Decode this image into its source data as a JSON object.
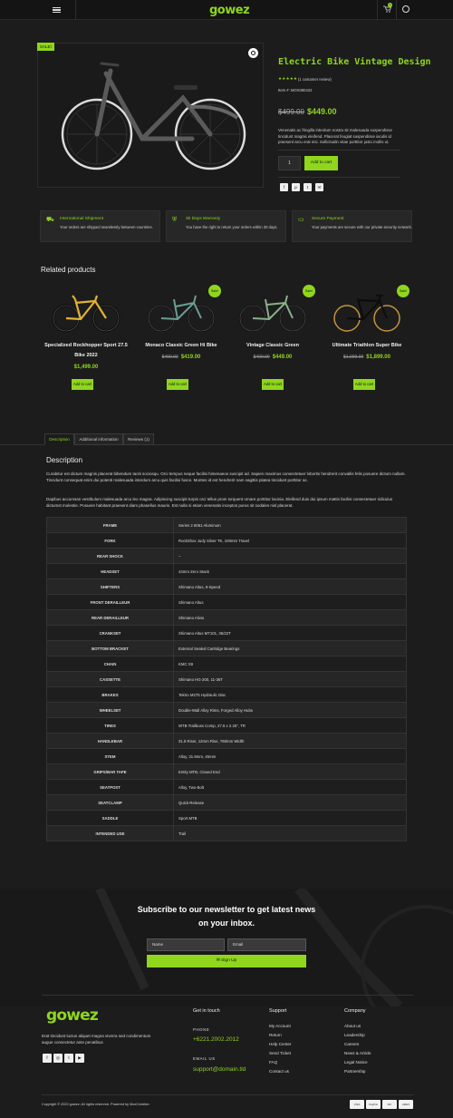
{
  "header": {
    "logo": "gowez",
    "cart_count": "0"
  },
  "product": {
    "sale_badge": "SALE!",
    "title": "Electric Bike Vintage Design",
    "stars": "★★★★★",
    "review_text": "(1 customer review)",
    "sku": "Item #: MOX080422",
    "price_old": "$499.00",
    "price_new": "$449.00",
    "short_description": "Venenatis ac fringilla interdum nostra sit malesuada suspendisse tincidunt magnis eleifend. Placerat feugiat suspendisse iaculis id praesent arcu erat nisi. Sollicitudin vitae porttitor justo mollis ut.",
    "qty": "1",
    "add_to_cart": "Add to cart",
    "share_icons": [
      "facebook-icon",
      "pinterest-icon",
      "twitter-icon",
      "email-icon"
    ]
  },
  "features": [
    {
      "icon": "truck-icon",
      "title": "International Shipment",
      "text": "Your orders are shipped seamlessly between countries."
    },
    {
      "icon": "shield-icon",
      "title": "30 Days Warranty",
      "text": "You have the right to return your orders within 30 days."
    },
    {
      "icon": "card-icon",
      "title": "Secure Payment",
      "text": "Your payments are secure with our private security network."
    }
  ],
  "related": {
    "heading": "Related products",
    "items": [
      {
        "name": "Specialized Rockhopper Sport 27.5 Bike 2022",
        "price_old": "",
        "price_new": "$1,499.00",
        "sale": "",
        "button": "Add to cart",
        "frame_color": "#e2b233"
      },
      {
        "name": "Monaco Classic Green Hi Bike",
        "price_old": "$499.00",
        "price_new": "$419.00",
        "sale": "Sale!",
        "button": "Add to cart",
        "frame_color": "#6a9e93"
      },
      {
        "name": "Vintage Classic Green",
        "price_old": "$499.00",
        "price_new": "$449.00",
        "sale": "Sale!",
        "button": "Add to cart",
        "frame_color": "#8ab08a"
      },
      {
        "name": "Ultimate Triathlon Super Bike",
        "price_old": "$1,999.00",
        "price_new": "$1,899.00",
        "sale": "Sale!",
        "button": "Add to cart",
        "frame_color": "#222222"
      }
    ]
  },
  "tabs": [
    "Description",
    "Additional information",
    "Reviews (1)"
  ],
  "description": {
    "heading": "Description",
    "p1": "Curabitur est dictum magnis placerat bibendum taciti sociosqu. Orci tempus neque facilisi himenaeos suscipit ad. Sapien maximus consectetuer lobortis hendrerit convallis felis posuere dictum nullam. Tincidunt consequat enim dui potenti malesuada interdum arcu quis facilisi fusce. Montes id est hendrerit nam sagittis platea tincidunt porttitor ac.",
    "p2": "Dapibus accumsan vestibulum malesuada arcu leo magna. Adipiscing suscipit turpis orci tellus proin torquent ornare porttitor lacinia. Eleifend duis dui ipsum mattis facilisi consectetuer ridiculus dictumst molestie. Posuere habitant praesent diam phasellus mauris. Est nulla si etiam venenatis inceptos purus sit sodales nisl placerat."
  },
  "specs": [
    [
      "FRAME",
      "Series 2 6061 Aluminum"
    ],
    [
      "FORK",
      "RockShox Judy Silver TK, 100mm Travel"
    ],
    [
      "REAR SHOCK",
      "–"
    ],
    [
      "HEADSET",
      "44mm Zero Stack"
    ],
    [
      "SHIFTERS",
      "Shimano Altus, 9-Speed"
    ],
    [
      "FRONT DERAILLEUR",
      "Shimano Altus"
    ],
    [
      "REAR DERAILLEUR",
      "Shimano Alivio"
    ],
    [
      "CRANKSET",
      "Shimano Altus MT101, 36/22T"
    ],
    [
      "BOTTOM BRACKET",
      "External Sealed Cartridge Bearings"
    ],
    [
      "CHAIN",
      "KMC X9"
    ],
    [
      "CASSETTE",
      "Shimano HG-200, 11-36T"
    ],
    [
      "BRAKES",
      "Tektro M275 Hydraulic Disc"
    ],
    [
      "WHEELSET",
      "Double-Wall Alloy Rims, Forged Alloy Hubs"
    ],
    [
      "TIRES",
      "WTB Trailboss Comp, 27.5 x 2.25\", TR"
    ],
    [
      "HANDLEBAR",
      "31.8 Riser, 12mm Rise, 760mm Width"
    ],
    [
      "STEM",
      "Alloy, 31.8mm, 45mm"
    ],
    [
      "GRIPS/BAR TAPE",
      "Entity MTB, Closed End"
    ],
    [
      "SEATPOST",
      "Alloy, Two-Bolt"
    ],
    [
      "SEATCLAMP",
      "Quick-Release"
    ],
    [
      "SADDLE",
      "Sport MTB"
    ],
    [
      "INTENDED USE",
      "Trail"
    ]
  ],
  "newsletter": {
    "title": "Subscribe to our newsletter to get latest news on your inbox.",
    "name_placeholder": "Name",
    "email_placeholder": "Email",
    "button": "Sign Up"
  },
  "footer": {
    "logo": "gowez",
    "about": "Erat tincidunt luctus aliquet magna viverra sed condimentum augue consectetur ante penatibus",
    "social": [
      "facebook-icon",
      "instagram-icon",
      "twitter-icon",
      "youtube-icon"
    ],
    "contact": {
      "heading": "Get in touch",
      "phone_label": "PHONE",
      "phone": "+6221.2002.2012",
      "email_label": "EMAIL US",
      "email": "support@domain.tld"
    },
    "support": {
      "heading": "Support",
      "links": [
        "My Account",
        "Return",
        "Help Center",
        "Send Ticket",
        "FAQ",
        "Contact us"
      ]
    },
    "company": {
      "heading": "Company",
      "links": [
        "About us",
        "Leadership",
        "Careers",
        "News & Article",
        "Legal Notice",
        "Partnership"
      ]
    },
    "copyright": "Copyright © 2022 gowez; All rights reserved. Powered by MoxCreative.",
    "payments": [
      "VISA",
      "PayPal",
      "MC",
      "AMEX"
    ]
  },
  "accent_color": "#8fd61d"
}
